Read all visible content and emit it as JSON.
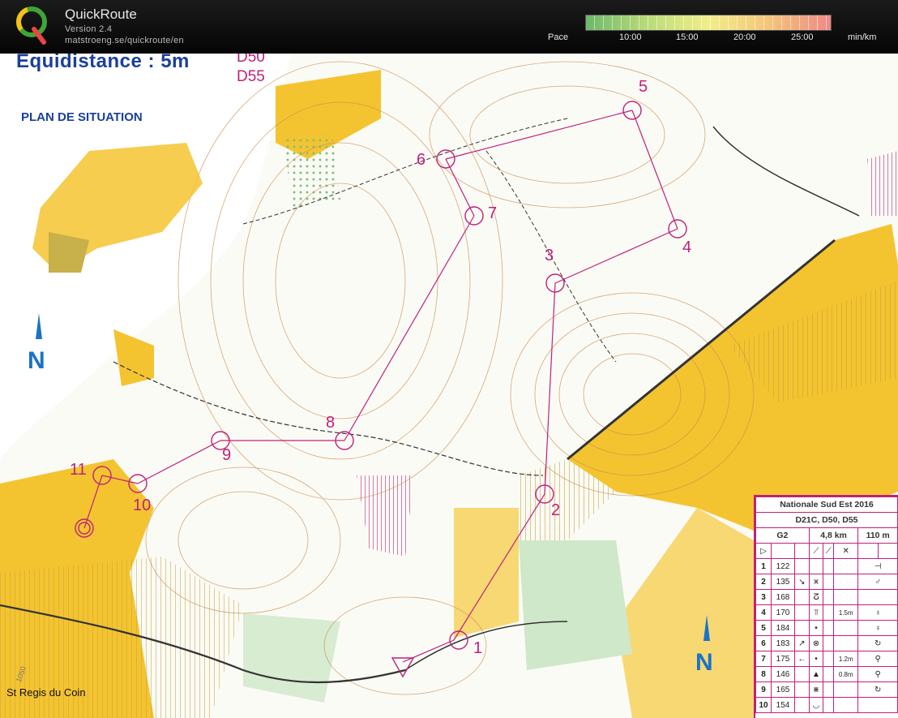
{
  "app": {
    "title": "QuickRoute",
    "version": "Version 2.4",
    "url": "matstroeng.se/quickroute/en",
    "logo_icon": "quickroute-q-logo-icon"
  },
  "pace": {
    "label": "Pace",
    "unit": "min/km",
    "ticks": [
      "10:00",
      "15:00",
      "20:00",
      "25:00"
    ],
    "colors": [
      "#6cb86a",
      "#b9db78",
      "#f2ee8a",
      "#f4c47a",
      "#ee8a86"
    ]
  },
  "map": {
    "equidistance": "Equidistance : 5m",
    "classes": [
      "D50",
      "D55"
    ],
    "situation_title": "PLAN DE SITUATION",
    "place_name": "St Regis du Coin",
    "spot_height": "1050",
    "north_icon": "north-arrow-icon",
    "controls": [
      "1",
      "2",
      "3",
      "4",
      "5",
      "6",
      "7",
      "8",
      "9",
      "10",
      "11"
    ]
  },
  "control_card": {
    "event": "Nationale Sud Est 2016",
    "classes": "D21C, D50, D55",
    "course": "G2",
    "length": "4,8 km",
    "climb": "110 m",
    "rows": [
      {
        "n": "1",
        "code": "122",
        "d1": "",
        "d2": "",
        "d3": "",
        "d4": "",
        "d5": "⊣"
      },
      {
        "n": "2",
        "code": "135",
        "d1": "↘",
        "d2": "⩙",
        "d3": "",
        "d4": "",
        "d5": "♂"
      },
      {
        "n": "3",
        "code": "168",
        "d1": "",
        "d2": "ⵒ",
        "d3": "",
        "d4": "",
        "d5": ""
      },
      {
        "n": "4",
        "code": "170",
        "d1": "",
        "d2": "⫪",
        "d3": "",
        "d4": "1.5m",
        "d5": "♁"
      },
      {
        "n": "5",
        "code": "184",
        "d1": "",
        "d2": "•",
        "d3": "",
        "d4": "",
        "d5": "♁"
      },
      {
        "n": "6",
        "code": "183",
        "d1": "↗",
        "d2": "⊗",
        "d3": "",
        "d4": "",
        "d5": "↻"
      },
      {
        "n": "7",
        "code": "175",
        "d1": "←",
        "d2": "•",
        "d3": "",
        "d4": "1.2m",
        "d5": "⚲"
      },
      {
        "n": "8",
        "code": "146",
        "d1": "",
        "d2": "▲",
        "d3": "",
        "d4": "0.8m",
        "d5": "⚲"
      },
      {
        "n": "9",
        "code": "165",
        "d1": "",
        "d2": "⋇",
        "d3": "",
        "d4": "",
        "d5": "↻"
      },
      {
        "n": "10",
        "code": "154",
        "d1": "",
        "d2": "◡",
        "d3": "",
        "d4": "",
        "d5": ""
      }
    ]
  }
}
